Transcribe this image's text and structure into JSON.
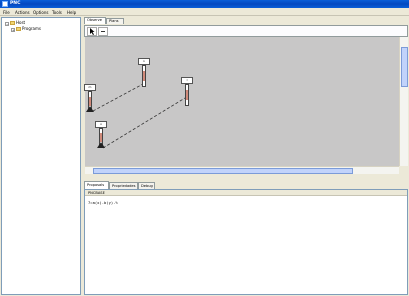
{
  "window": {
    "title": "PNC"
  },
  "menu": [
    "File",
    "Actions",
    "Options",
    "Tools",
    "Help"
  ],
  "tree": [
    {
      "label": "Host",
      "level": 0
    },
    {
      "label": "Programs",
      "level": 1
    }
  ],
  "editor_tabs": [
    "Observe",
    "Plans"
  ],
  "bottom_tabs": [
    "Proposals",
    "Propriedades",
    "Debug"
  ],
  "bottom_panel": {
    "header": "PNCBASE",
    "content": "7=a(x).b(y).%"
  },
  "canvas_nodes": [
    {
      "label": "m"
    },
    {
      "label": "n"
    },
    {
      "label": "l"
    },
    {
      "label": "o"
    }
  ]
}
